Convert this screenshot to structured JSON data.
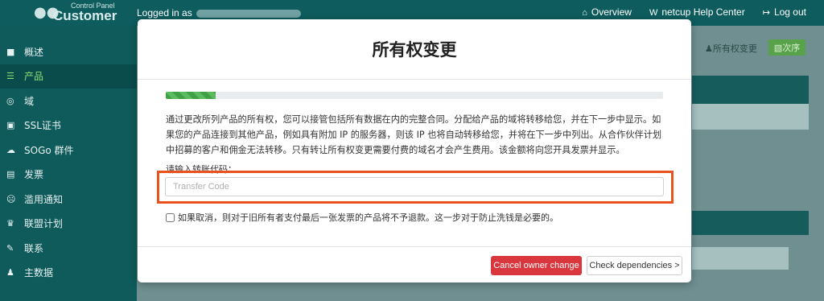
{
  "header": {
    "logo_small": "Control Panel",
    "logo_big": "Customer",
    "logged_in_prefix": "Logged in as",
    "links": [
      {
        "icon": "home-icon",
        "label": "Overview"
      },
      {
        "icon": "help-icon",
        "label": "netcup Help Center"
      },
      {
        "icon": "logout-icon",
        "label": "Log out"
      }
    ]
  },
  "sidebar": {
    "items": [
      {
        "icon": "dashboard-icon",
        "label": "概述"
      },
      {
        "icon": "database-icon",
        "label": "产品",
        "active": true
      },
      {
        "icon": "globe-icon",
        "label": "域"
      },
      {
        "icon": "lock-icon",
        "label": "SSL证书"
      },
      {
        "icon": "cloud-icon",
        "label": "SOGo 群件"
      },
      {
        "icon": "money-icon",
        "label": "发票"
      },
      {
        "icon": "frown-icon",
        "label": "滥用通知"
      },
      {
        "icon": "trophy-icon",
        "label": "联盟计划"
      },
      {
        "icon": "edit-icon",
        "label": "联系"
      },
      {
        "icon": "user-icon",
        "label": "主数据"
      }
    ]
  },
  "background": {
    "owner_change_label": "所有权变更",
    "order_label": "次序"
  },
  "modal": {
    "title": "所有权变更",
    "progress": 0.1,
    "description": "通过更改所列产品的所有权，您可以接管包括所有数据在内的完整合同。分配给产品的域将转移给您，并在下一步中显示。如果您的产品连接到其他产品，例如具有附加 IP 的服务器，则该 IP 也将自动转移给您，并将在下一步中列出。从合作伙伴计划中招募的客户和佣金无法转移。只有转让所有权变更需要付费的域名才会产生费用。该金额将向您开具发票并显示。",
    "input_label": "请输入转账代码：",
    "input_placeholder": "Transfer Code",
    "input_value": "",
    "checkbox_label": "如果取消，则对于旧所有者支付最后一张发票的产品将不予退款。这一步对于防止洗钱是必要的。",
    "cancel_button": "Cancel owner change",
    "check_button": "Check dependencies >"
  },
  "colors": {
    "topbar": "#0e5c5e",
    "active_item": "#8ce070",
    "cancel": "#d9363e",
    "highlight": "#e8521d",
    "progress": "#3fa046"
  }
}
